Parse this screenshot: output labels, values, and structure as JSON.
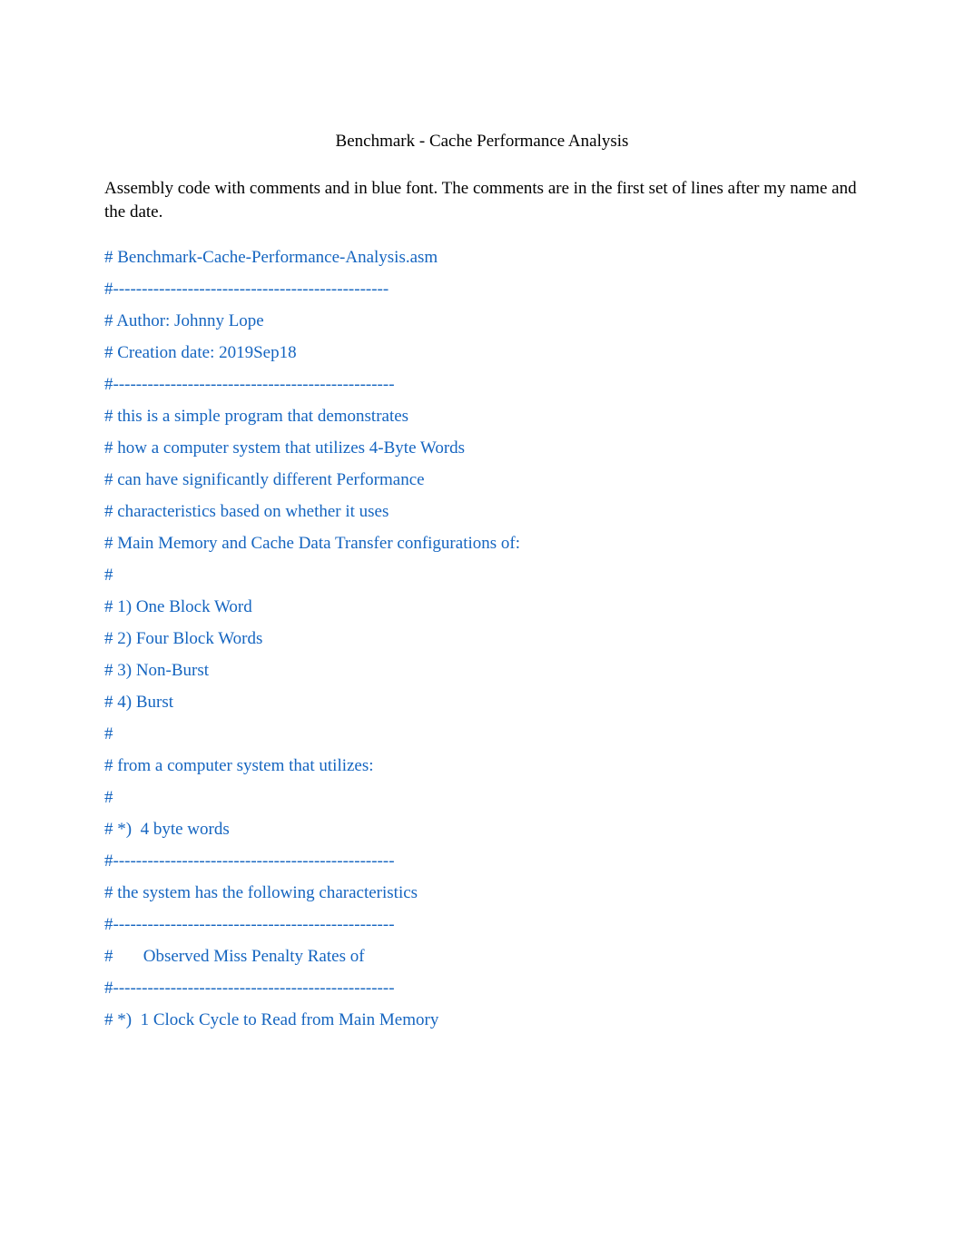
{
  "title": "Benchmark - Cache Performance Analysis",
  "intro": "Assembly code with comments and in blue font. The comments are in the first set of lines after my name and the date.",
  "codeLines": [
    "# Benchmark-Cache-Performance-Analysis.asm",
    "#------------------------------------------------",
    "# Author: Johnny Lope",
    "# Creation date: 2019Sep18",
    "#-------------------------------------------------",
    "# this is a simple program that demonstrates",
    "# how a computer system that utilizes 4-Byte Words",
    "# can have significantly different Performance",
    "# characteristics based on whether it uses",
    "# Main Memory and Cache Data Transfer configurations of:",
    "#",
    "# 1) One Block Word",
    "# 2) Four Block Words",
    "# 3) Non-Burst",
    "# 4) Burst",
    "#",
    "# from a computer system that utilizes:",
    "#",
    "# *)  4 byte words",
    "#-------------------------------------------------",
    "# the system has the following characteristics",
    "#-------------------------------------------------",
    "#       Observed Miss Penalty Rates of",
    "#-------------------------------------------------",
    "# *)  1 Clock Cycle to Read from Main Memory"
  ]
}
